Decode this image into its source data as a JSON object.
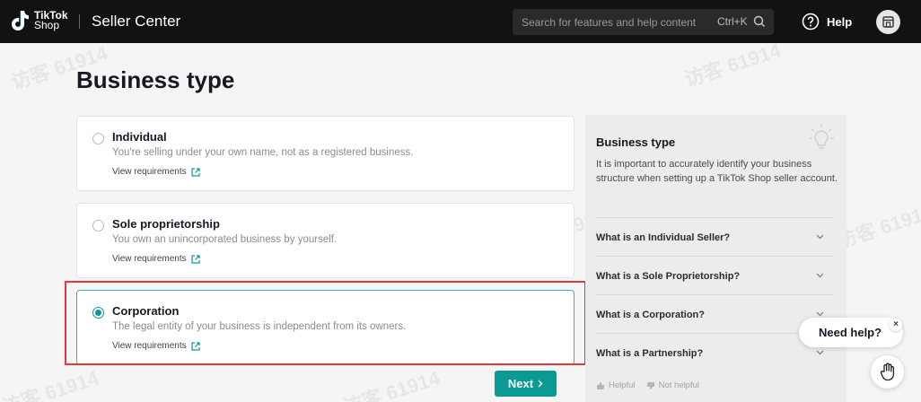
{
  "header": {
    "logo_line1": "TikTok",
    "logo_line2": "Shop",
    "title": "Seller Center",
    "search_placeholder": "Search for features and help content",
    "search_shortcut": "Ctrl+K",
    "help_label": "Help"
  },
  "page": {
    "title": "Business type"
  },
  "options": [
    {
      "title": "Individual",
      "description": "You're selling under your own name, not as a registered business.",
      "link": "View requirements",
      "selected": false
    },
    {
      "title": "Sole proprietorship",
      "description": "You own an unincorporated business by yourself.",
      "link": "View requirements",
      "selected": false
    },
    {
      "title": "Corporation",
      "description": "The legal entity of your business is independent from its owners.",
      "link": "View requirements",
      "selected": true
    }
  ],
  "next_label": "Next",
  "side_panel": {
    "title": "Business type",
    "text": "It is important to accurately identify your business structure when setting up a TikTok Shop seller account.",
    "faqs": [
      "What is an Individual Seller?",
      "What is a Sole Proprietorship?",
      "What is a Corporation?",
      "What is a Partnership?"
    ],
    "helpful": "Helpful",
    "not_helpful": "Not helpful"
  },
  "widget": {
    "need_help": "Need help?",
    "close": "×"
  },
  "watermark": "访客 61914",
  "colors": {
    "accent": "#0b9a93",
    "highlight": "#e03a3a",
    "header_bg": "#121212"
  }
}
